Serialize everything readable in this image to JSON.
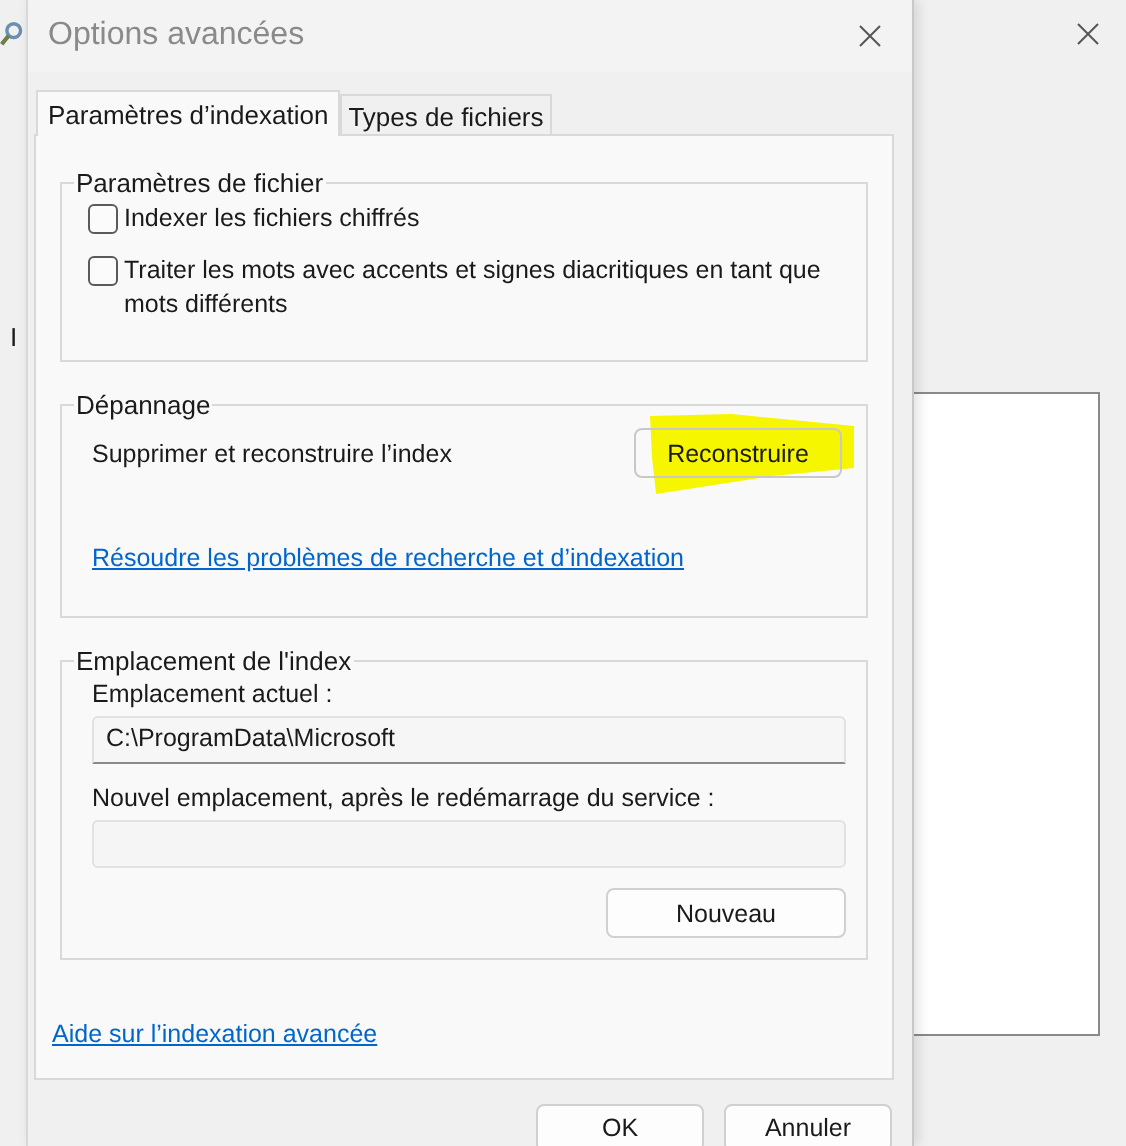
{
  "background_window": {
    "partial_label": "I"
  },
  "dialog": {
    "title": "Options avancées"
  },
  "tabs": [
    {
      "label": "Paramètres d’indexation",
      "selected": true
    },
    {
      "label": "Types de fichiers",
      "selected": false
    }
  ],
  "file_settings": {
    "title": "Paramètres de fichier",
    "options": [
      {
        "label": "Indexer les fichiers chiffrés",
        "checked": false
      },
      {
        "label": "Traiter les mots avec accents et signes diacritiques en tant que mots différents",
        "checked": false
      }
    ]
  },
  "troubleshooting": {
    "title": "Dépannage",
    "action_label": "Supprimer et reconstruire l’index",
    "button": "Reconstruire",
    "highlighted": true,
    "link": "Résoudre les problèmes de recherche et d’indexation"
  },
  "index_location": {
    "title": "Emplacement de l'index",
    "current_label": "Emplacement actuel :",
    "current_value": "C:\\ProgramData\\Microsoft",
    "new_label": "Nouvel emplacement, après le redémarrage du service :",
    "button": "Nouveau"
  },
  "help_link": "Aide sur l’indexation avancée",
  "buttons": [
    "OK",
    "Annuler"
  ]
}
